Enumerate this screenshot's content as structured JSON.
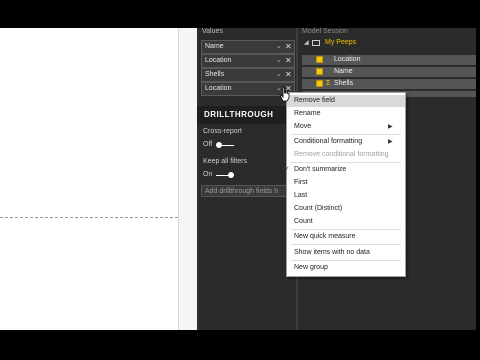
{
  "viz_pane": {
    "values_title": "Values",
    "wells": [
      {
        "label": "Name"
      },
      {
        "label": "Location"
      },
      {
        "label": "Shells"
      },
      {
        "label": "Location"
      }
    ],
    "drillthrough_title": "DRILLTHROUGH",
    "cross_report_label": "Cross-report",
    "cross_report_state": "Off",
    "keep_filters_label": "Keep all filters",
    "keep_filters_state": "On",
    "add_drill_placeholder": "Add drillthrough fields h"
  },
  "fields_pane": {
    "top_partial": "Model Session",
    "table_name": "My Peeps",
    "fields": [
      {
        "name": "Location",
        "checked": true
      },
      {
        "name": "Name",
        "checked": true
      },
      {
        "name": "Shells",
        "checked": true,
        "sigma": "Σ"
      }
    ]
  },
  "context_menu": {
    "items": [
      {
        "label": "Remove field",
        "highlighted": true
      },
      {
        "label": "Rename"
      },
      {
        "label": "Move",
        "submenu": true
      },
      {
        "label": "Conditional formatting",
        "submenu": true
      },
      {
        "label": "Remove conditional formatting",
        "disabled": true
      },
      {
        "label": "Don't summarize",
        "checked": true
      },
      {
        "label": "First"
      },
      {
        "label": "Last"
      },
      {
        "label": "Count (Distinct)"
      },
      {
        "label": "Count"
      },
      {
        "label": "New quick measure"
      },
      {
        "label": "Show items with no data"
      },
      {
        "label": "New group"
      }
    ],
    "submenu_glyph": "▶",
    "check_glyph": "✓"
  },
  "glyphs": {
    "chevron": "⌄",
    "close": "✕",
    "collapse": "◢"
  },
  "colors": {
    "pane_bg": "#2b2b2b",
    "accent_yellow": "#f2c811",
    "menu_highlight": "#d9d9d9"
  }
}
